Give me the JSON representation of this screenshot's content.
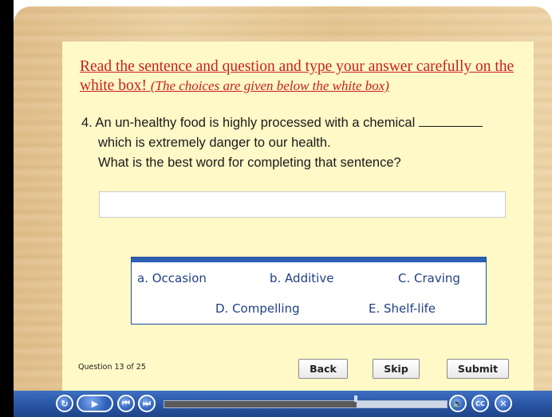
{
  "instruction": {
    "main": "Read the sentence and question and type your answer carefully on the white box!",
    "note": "(The choices are given below the white box)"
  },
  "question": {
    "line1": "4. An un-healthy food is highly processed with a chemical",
    "line2": "which is extremely danger to our health.",
    "line3": "What is the best word for completing that sentence?"
  },
  "answer": {
    "value": "",
    "placeholder": ""
  },
  "choices": [
    "a. Occasion",
    "b. Additive",
    "C. Craving",
    "D. Compelling",
    "E. Shelf-life"
  ],
  "progress_text": "Question 13 of 25",
  "buttons": {
    "back": "Back",
    "skip": "Skip",
    "submit": "Submit"
  },
  "player": {
    "restart_icon": "restart-icon",
    "play_icon": "play-icon",
    "prev_icon": "previous-icon",
    "next_icon": "next-icon",
    "volume_icon": "volume-icon",
    "cc_label": "CC",
    "close_icon": "close-icon",
    "playback_progress": 0.68
  },
  "colors": {
    "instruction": "#cc1f1f",
    "choices_text": "#1f3f86",
    "toolbar": "#2a56a6",
    "slide_bg": "#fff8c7"
  }
}
